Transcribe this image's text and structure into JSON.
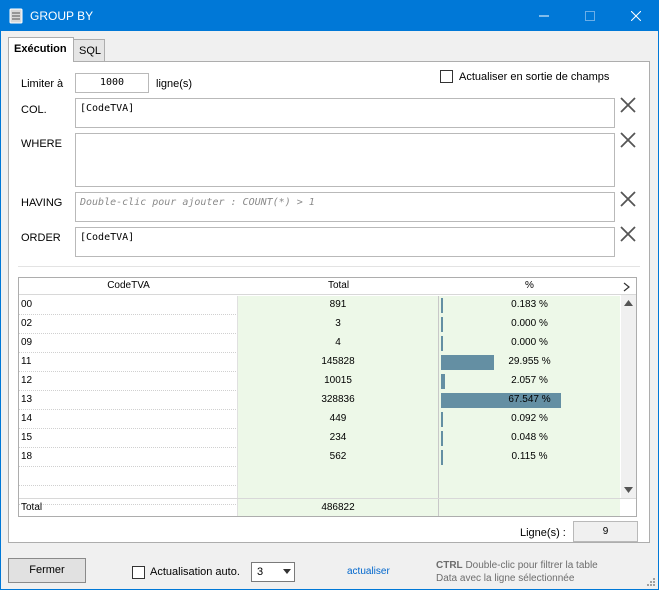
{
  "window": {
    "title": "GROUP BY"
  },
  "tabs": [
    {
      "label": "Exécution",
      "active": true
    },
    {
      "label": "SQL",
      "active": false
    }
  ],
  "form": {
    "limit_label": "Limiter à",
    "limit_value": "1000",
    "limit_unit": "ligne(s)",
    "refresh_on_exit_label": "Actualiser en sortie de champs",
    "refresh_on_exit_checked": false,
    "col_label": "COL.",
    "col_value": "[CodeTVA]",
    "where_label": "WHERE",
    "where_value": "",
    "having_label": "HAVING",
    "having_placeholder": "Double-clic pour ajouter : COUNT(*) > 1",
    "order_label": "ORDER",
    "order_value": "[CodeTVA]"
  },
  "grid": {
    "columns": [
      "CodeTVA",
      "Total",
      "%"
    ],
    "rows": [
      {
        "code": "00",
        "total": "891",
        "pct": "0.183 %",
        "fraction": 0.00183
      },
      {
        "code": "02",
        "total": "3",
        "pct": "0.000 %",
        "fraction": 0.0
      },
      {
        "code": "09",
        "total": "4",
        "pct": "0.000 %",
        "fraction": 0.0
      },
      {
        "code": "11",
        "total": "145828",
        "pct": "29.955 %",
        "fraction": 0.29955
      },
      {
        "code": "12",
        "total": "10015",
        "pct": "2.057 %",
        "fraction": 0.02057
      },
      {
        "code": "13",
        "total": "328836",
        "pct": "67.547 %",
        "fraction": 0.67547
      },
      {
        "code": "14",
        "total": "449",
        "pct": "0.092 %",
        "fraction": 0.00092
      },
      {
        "code": "15",
        "total": "234",
        "pct": "0.048 %",
        "fraction": 0.00048
      },
      {
        "code": "18",
        "total": "562",
        "pct": "0.115 %",
        "fraction": 0.00115
      }
    ],
    "total_label": "Total",
    "total_value": "486822",
    "bar_color": "#648fa3",
    "highlight_color": "#edf8e8"
  },
  "rowcount": {
    "label": "Ligne(s) :",
    "value": "9"
  },
  "footer": {
    "close_button": "Fermer",
    "auto_refresh_label": "Actualisation auto.",
    "auto_refresh_checked": false,
    "interval_value": "3",
    "refresh_link": "actualiser",
    "hint_key": "CTRL",
    "hint_line1": "Double-clic pour filtrer la table",
    "hint_line2": "Data avec la ligne sélectionnée"
  }
}
